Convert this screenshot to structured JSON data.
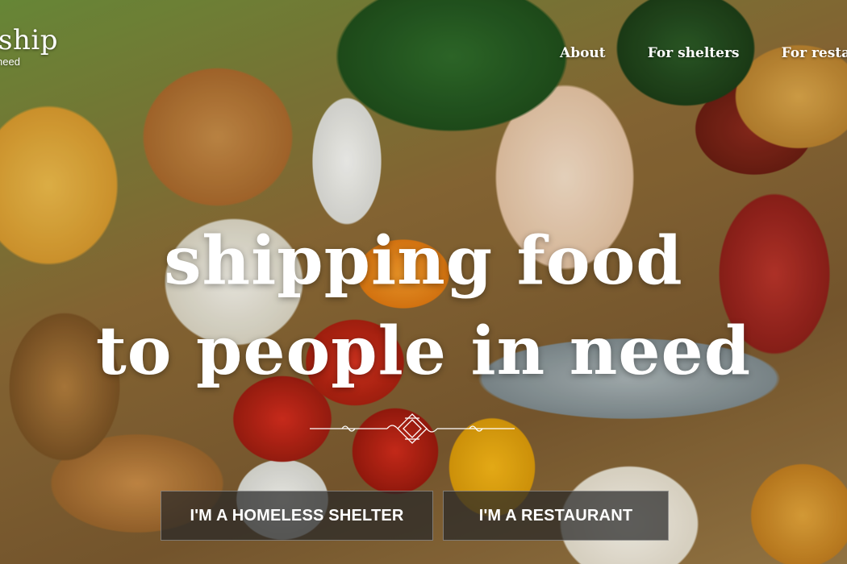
{
  "brand": {
    "name": "ship",
    "tagline": "need"
  },
  "nav": {
    "items": [
      {
        "label": "About"
      },
      {
        "label": "For shelters"
      },
      {
        "label": "For restau"
      }
    ]
  },
  "hero": {
    "headline_line1": "shipping food",
    "headline_line2": "to people in need",
    "background_image": "grocery-food-spread",
    "ornament_icon": "ornamental-divider-icon"
  },
  "cta": {
    "shelter_label": "I'M A HOMELESS SHELTER",
    "restaurant_label": "I'M A RESTAURANT"
  },
  "colors": {
    "text": "#ffffff",
    "button_bg": "#282828"
  }
}
